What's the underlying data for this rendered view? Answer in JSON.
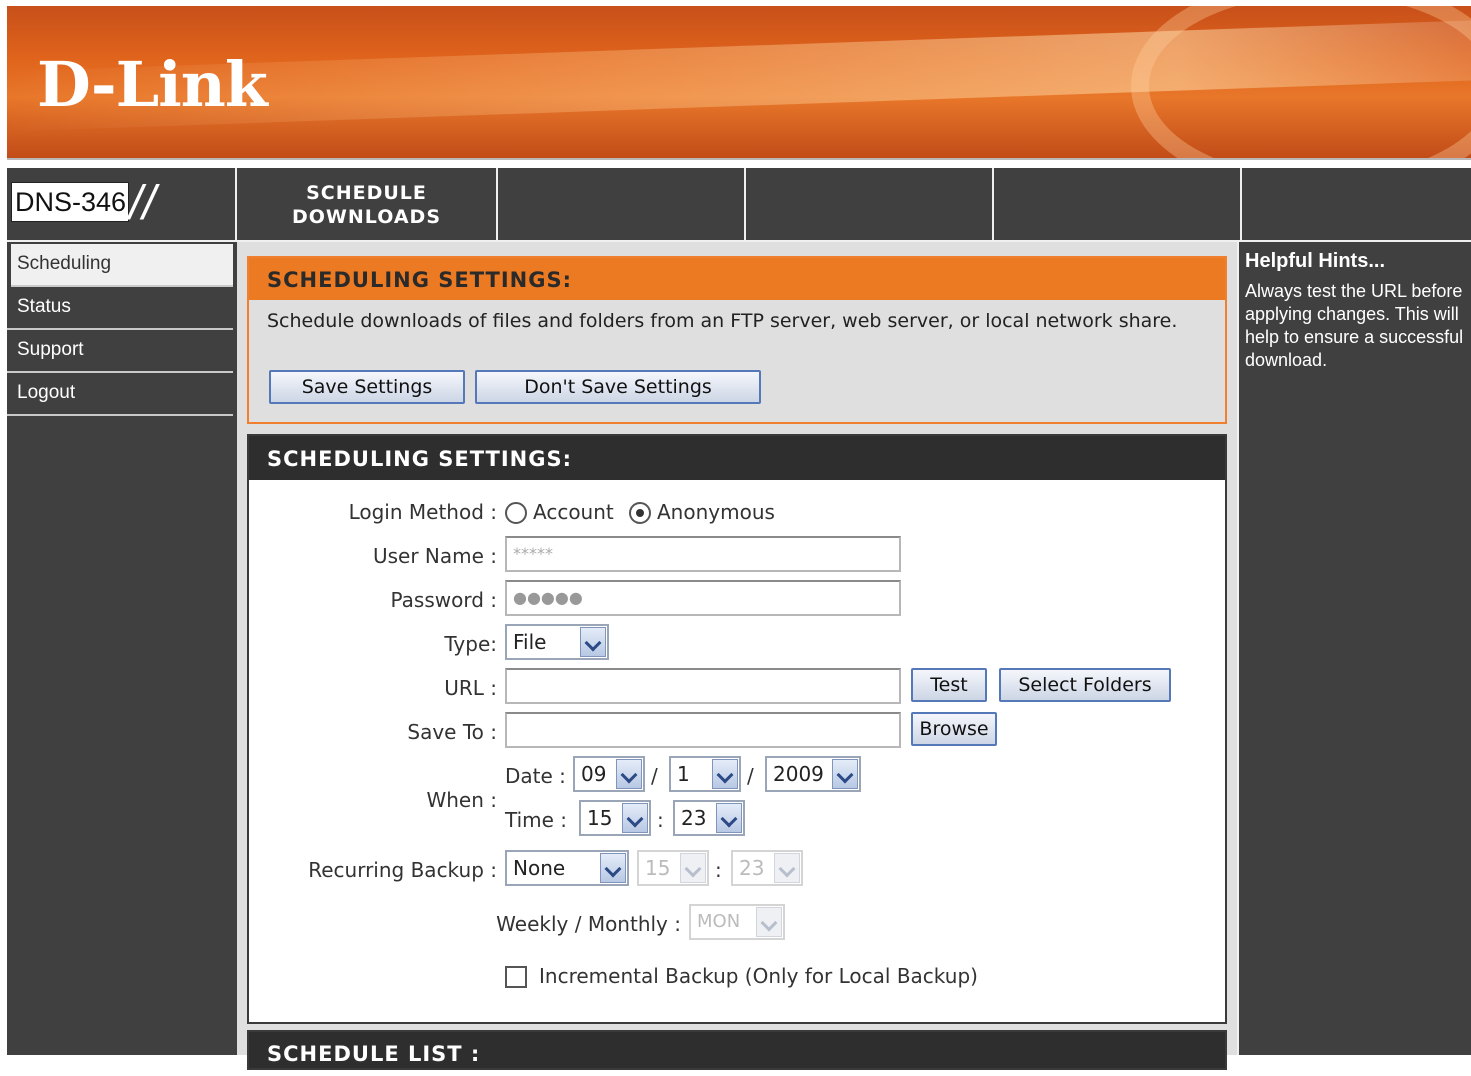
{
  "brand": {
    "logo": "D-Link",
    "model": "DNS-346",
    "model_slashes": "//"
  },
  "topnav": {
    "tabs": [
      "SCHEDULE DOWNLOADS",
      "",
      "",
      ""
    ]
  },
  "sidebar": {
    "items": [
      {
        "label": "Scheduling",
        "active": true
      },
      {
        "label": "Status",
        "active": false
      },
      {
        "label": "Support",
        "active": false
      },
      {
        "label": "Logout",
        "active": false
      }
    ]
  },
  "hints": {
    "title": "Helpful Hints...",
    "text": "Always test the URL before\napplying changes. This will\nhelp to ensure a successful\ndownload."
  },
  "settings_panel": {
    "title": "SCHEDULING SETTINGS:",
    "description": "Schedule downloads of files and folders from an FTP server, web server, or local network share.",
    "save_label": "Save Settings",
    "dont_save_label": "Don't Save Settings"
  },
  "form": {
    "title": "SCHEDULING SETTINGS:",
    "login_method_label": "Login Method :",
    "login_options": [
      "Account",
      "Anonymous"
    ],
    "login_selected": "Anonymous",
    "username_label": "User Name :",
    "username_value": "*****",
    "password_label": "Password :",
    "password_value": "●●●●●",
    "type_label": "Type:",
    "type_value": "File",
    "url_label": "URL :",
    "url_value": "",
    "test_label": "Test",
    "select_folders_label": "Select Folders",
    "save_to_label": "Save To :",
    "save_to_value": "",
    "browse_label": "Browse",
    "when_label": "When :",
    "date_label": "Date :",
    "date_month": "09",
    "date_day": "1",
    "date_year": "2009",
    "date_sep": "/",
    "time_label": "Time :",
    "time_hour": "15",
    "time_minute": "23",
    "time_sep": ":",
    "recurring_label": "Recurring Backup :",
    "recurring_value": "None",
    "recurring_hour": "15",
    "recurring_minute": "23",
    "weekly_label": "Weekly / Monthly :",
    "weekly_value": "MON",
    "incremental_label": "Incremental Backup (Only for Local Backup)",
    "incremental_checked": false
  },
  "schedule_list": {
    "title": "SCHEDULE LIST :"
  }
}
